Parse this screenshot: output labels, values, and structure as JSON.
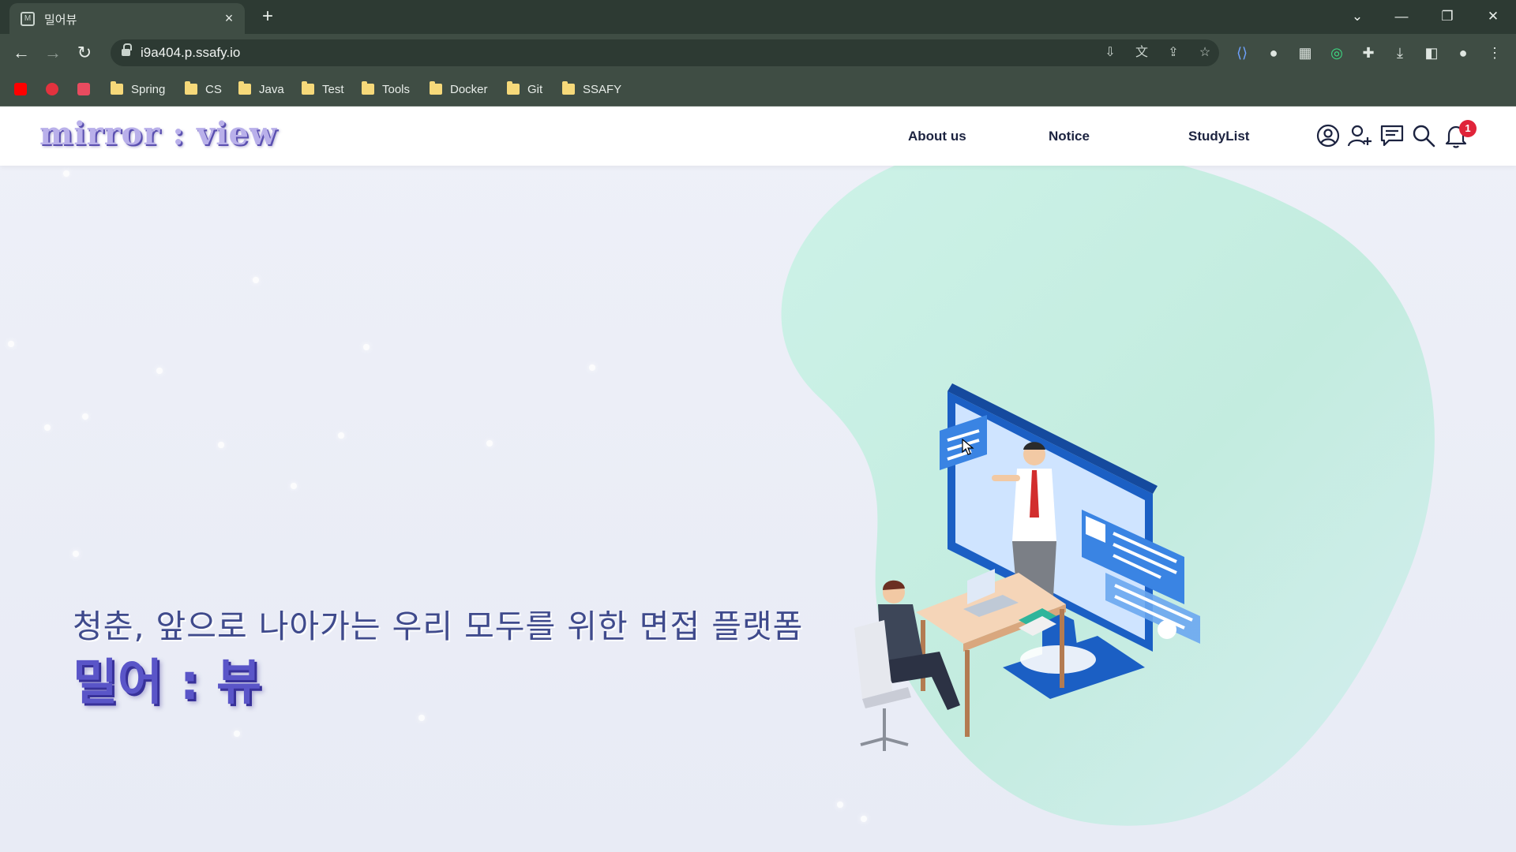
{
  "browser": {
    "tab_title": "밀어뷰",
    "tab_close": "×",
    "new_tab": "+",
    "url": "i9a404.p.ssafy.io",
    "window_controls": {
      "tabs_menu": "⌄",
      "minimize": "—",
      "restore": "❐",
      "close": "✕"
    },
    "bookmarks": [
      {
        "label": "",
        "icon": "youtube-icon",
        "color": "#ff0000"
      },
      {
        "label": "",
        "icon": "circle-play-icon",
        "color": "#e3323e"
      },
      {
        "label": "",
        "icon": "c-icon",
        "color": "#e94b5f"
      },
      {
        "label": "Spring",
        "icon": "folder-icon"
      },
      {
        "label": "CS",
        "icon": "folder-icon"
      },
      {
        "label": "Java",
        "icon": "folder-icon"
      },
      {
        "label": "Test",
        "icon": "folder-icon"
      },
      {
        "label": "Tools",
        "icon": "folder-icon"
      },
      {
        "label": "Docker",
        "icon": "folder-icon"
      },
      {
        "label": "Git",
        "icon": "folder-icon"
      },
      {
        "label": "SSAFY",
        "icon": "folder-icon"
      }
    ]
  },
  "site": {
    "logo": "mirror : view",
    "nav": [
      {
        "label": "About us"
      },
      {
        "label": "Notice"
      },
      {
        "label": "StudyList"
      }
    ],
    "header_icons": [
      "profile-icon",
      "add-user-icon",
      "chat-icon",
      "search-icon",
      "bell-icon"
    ],
    "notification_count": "1",
    "hero": {
      "subtitle": "청춘, 앞으로 나아가는 우리 모두를 위한 면접 플랫폼",
      "title": "밀어 : 뷰"
    }
  },
  "colors": {
    "chrome_dark": "#2d3a33",
    "chrome": "#3f4d44",
    "page_bg": "#eef0f8",
    "blob": "#c8eee3",
    "brand_purple": "#5a55c8",
    "badge_red": "#e0243a"
  }
}
